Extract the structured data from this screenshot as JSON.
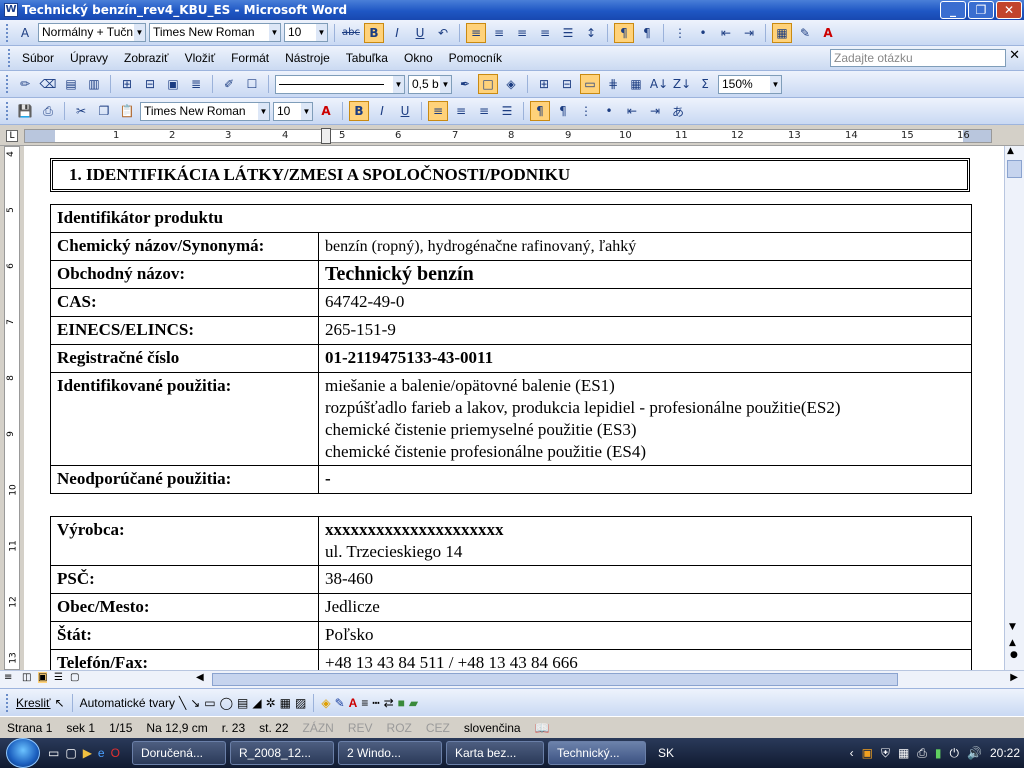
{
  "window": {
    "title": "Technický benzín_rev4_KBU_ES - Microsoft Word"
  },
  "toolbar1": {
    "style": "Normálny + Tučn",
    "font": "Times New Roman",
    "size": "10"
  },
  "menu": {
    "items": [
      "Súbor",
      "Úpravy",
      "Zobraziť",
      "Vložiť",
      "Formát",
      "Nástroje",
      "Tabuľka",
      "Okno",
      "Pomocník"
    ],
    "ask_placeholder": "Zadajte otázku"
  },
  "toolbar2": {
    "line_width": "0,5 b",
    "zoom": "150%"
  },
  "toolbar3": {
    "font": "Times New Roman",
    "size": "10"
  },
  "ruler": {
    "h_numbers": [
      "1",
      "2",
      "3",
      "4",
      "5",
      "6",
      "7",
      "8",
      "9",
      "10",
      "11",
      "12",
      "13",
      "14",
      "15",
      "16"
    ],
    "v_numbers": [
      "4",
      "5",
      "6",
      "7",
      "8",
      "9",
      "10",
      "11",
      "12",
      "13"
    ]
  },
  "document": {
    "section_title": "1. IDENTIFIKÁCIA LÁTKY/ZMESI A SPOLOČNOSTI/PODNIKU",
    "product_header": "Identifikátor produktu",
    "rows1": [
      {
        "label": "Chemický názov/Synonymá:",
        "value": "benzín (ropný), hydrogénačne rafinovaný, ľahký"
      },
      {
        "label": "Obchodný názov:",
        "value": "Technický benzín"
      },
      {
        "label": "CAS:",
        "value": "64742-49-0"
      },
      {
        "label": "EINECS/ELINCS:",
        "value": "265-151-9"
      },
      {
        "label": "Registračné číslo",
        "value": "01-2119475133-43-0011"
      },
      {
        "label": "Identifikované použitia:",
        "values": [
          "miešanie a balenie/opätovné balenie (ES1)",
          "rozpúšťadlo farieb a lakov,  produkcia lepidiel  - profesionálne použitie(ES2)",
          "chemické čistenie priemyselné použitie (ES3)",
          "chemické čistenie profesionálne použitie (ES4)"
        ]
      },
      {
        "label": "Neodporúčané použitia:",
        "value": "-"
      }
    ],
    "rows2": [
      {
        "label": "Výrobca:",
        "values": [
          "xxxxxxxxxxxxxxxxxxxxx",
          "ul. Trzecieskiego 14"
        ]
      },
      {
        "label": "PSČ:",
        "value": "38-460"
      },
      {
        "label": "Obec/Mesto:",
        "value": "Jedlicze"
      },
      {
        "label": "Štát:",
        "value": "Poľsko"
      },
      {
        "label": "Telefón/Fax:",
        "value": "+48 13 43 84 511 / +48 13 43 84 666"
      }
    ]
  },
  "drawbar": {
    "draw": "Kresliť",
    "shapes": "Automatické tvary"
  },
  "status": {
    "page": "Strana  1",
    "section": "sek  1",
    "pages": "1/15",
    "position": "Na  12,9 cm",
    "line": "r.  23",
    "column": "st.  22",
    "rec": "ZÁZN",
    "rev": "REV",
    "ext": "ROZ",
    "ovr": "CEZ",
    "language": "slovenčina"
  },
  "taskbar": {
    "tasks": [
      "Doručená...",
      "R_2008_12...",
      "2 Windo...",
      "Karta bez...",
      "Technický..."
    ],
    "lang": "SK",
    "clock": "20:22"
  }
}
